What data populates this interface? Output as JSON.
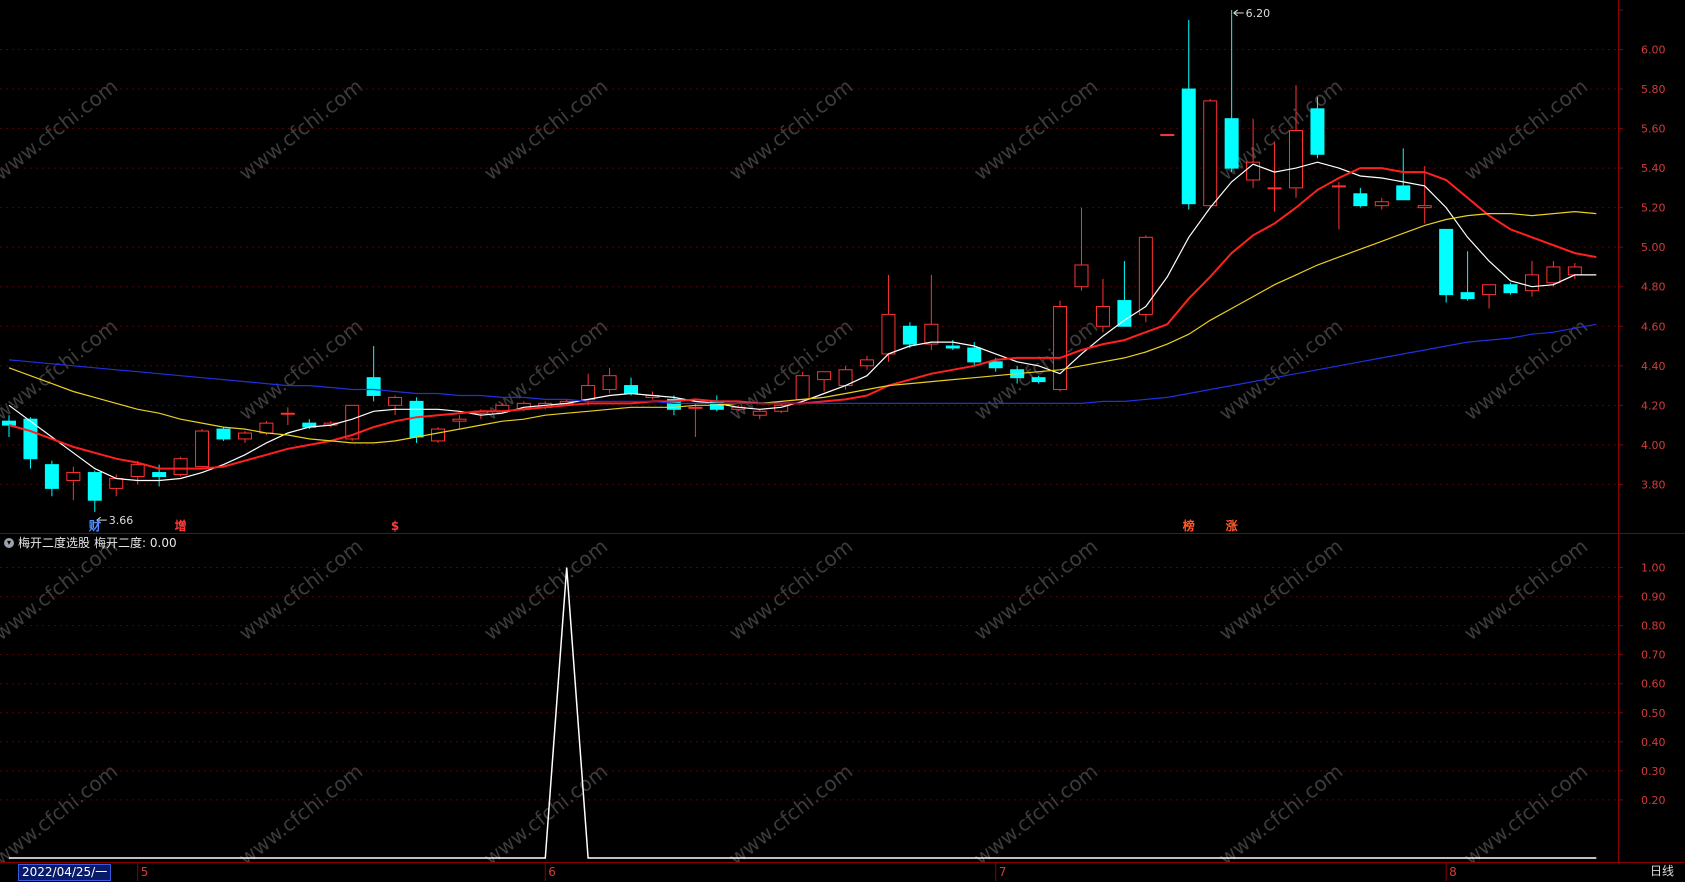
{
  "chart_data": [
    {
      "type": "candlestick",
      "ylim": [
        3.62,
        6.22
      ],
      "y_ticks": [
        3.8,
        4.0,
        4.2,
        4.4,
        4.6,
        4.8,
        5.0,
        5.2,
        5.4,
        5.6,
        5.8,
        6.0
      ],
      "y_tick_labels": [
        "3.80",
        "4.00",
        "4.20",
        "4.40",
        "4.60",
        "4.80",
        "5.00",
        "5.20",
        "5.40",
        "5.60",
        "5.80",
        "6.00"
      ],
      "x_month_labels": [
        {
          "label": "5",
          "index": 6
        },
        {
          "label": "6",
          "index": 25
        },
        {
          "label": "7",
          "index": 46
        },
        {
          "label": "8",
          "index": 67
        }
      ],
      "candles": [
        {
          "o": 4.12,
          "h": 4.15,
          "l": 4.04,
          "c": 4.1
        },
        {
          "o": 4.13,
          "h": 4.14,
          "l": 3.88,
          "c": 3.93
        },
        {
          "o": 3.9,
          "h": 3.92,
          "l": 3.74,
          "c": 3.78
        },
        {
          "o": 3.82,
          "h": 3.89,
          "l": 3.72,
          "c": 3.86
        },
        {
          "o": 3.86,
          "h": 3.87,
          "l": 3.66,
          "c": 3.72
        },
        {
          "o": 3.78,
          "h": 3.85,
          "l": 3.74,
          "c": 3.83
        },
        {
          "o": 3.84,
          "h": 3.92,
          "l": 3.8,
          "c": 3.9
        },
        {
          "o": 3.86,
          "h": 3.9,
          "l": 3.79,
          "c": 3.84
        },
        {
          "o": 3.85,
          "h": 3.94,
          "l": 3.84,
          "c": 3.93
        },
        {
          "o": 3.89,
          "h": 4.08,
          "l": 3.88,
          "c": 4.07
        },
        {
          "o": 4.08,
          "h": 4.09,
          "l": 4.02,
          "c": 4.03
        },
        {
          "o": 4.03,
          "h": 4.07,
          "l": 4.01,
          "c": 4.06
        },
        {
          "o": 4.06,
          "h": 4.12,
          "l": 4.05,
          "c": 4.11
        },
        {
          "o": 4.16,
          "h": 4.19,
          "l": 4.1,
          "c": 4.16
        },
        {
          "o": 4.11,
          "h": 4.13,
          "l": 4.08,
          "c": 4.09
        },
        {
          "o": 4.1,
          "h": 4.12,
          "l": 4.09,
          "c": 4.11
        },
        {
          "o": 4.03,
          "h": 4.2,
          "l": 4.02,
          "c": 4.2
        },
        {
          "o": 4.34,
          "h": 4.5,
          "l": 4.22,
          "c": 4.25
        },
        {
          "o": 4.2,
          "h": 4.25,
          "l": 4.15,
          "c": 4.24
        },
        {
          "o": 4.22,
          "h": 4.24,
          "l": 4.01,
          "c": 4.04
        },
        {
          "o": 4.02,
          "h": 4.09,
          "l": 4.01,
          "c": 4.08
        },
        {
          "o": 4.12,
          "h": 4.15,
          "l": 4.08,
          "c": 4.13
        },
        {
          "o": 4.16,
          "h": 4.18,
          "l": 4.13,
          "c": 4.17
        },
        {
          "o": 4.17,
          "h": 4.21,
          "l": 4.16,
          "c": 4.2
        },
        {
          "o": 4.18,
          "h": 4.22,
          "l": 4.17,
          "c": 4.21
        },
        {
          "o": 4.19,
          "h": 4.22,
          "l": 4.18,
          "c": 4.21
        },
        {
          "o": 4.21,
          "h": 4.23,
          "l": 4.2,
          "c": 4.22
        },
        {
          "o": 4.23,
          "h": 4.36,
          "l": 4.2,
          "c": 4.3
        },
        {
          "o": 4.28,
          "h": 4.39,
          "l": 4.26,
          "c": 4.35
        },
        {
          "o": 4.3,
          "h": 4.34,
          "l": 4.25,
          "c": 4.26
        },
        {
          "o": 4.24,
          "h": 4.27,
          "l": 4.23,
          "c": 4.25
        },
        {
          "o": 4.23,
          "h": 4.25,
          "l": 4.15,
          "c": 4.18
        },
        {
          "o": 4.19,
          "h": 4.21,
          "l": 4.04,
          "c": 4.19
        },
        {
          "o": 4.22,
          "h": 4.25,
          "l": 4.17,
          "c": 4.18
        },
        {
          "o": 4.18,
          "h": 4.2,
          "l": 4.17,
          "c": 4.19
        },
        {
          "o": 4.15,
          "h": 4.18,
          "l": 4.13,
          "c": 4.17
        },
        {
          "o": 4.17,
          "h": 4.21,
          "l": 4.16,
          "c": 4.2
        },
        {
          "o": 4.23,
          "h": 4.37,
          "l": 4.22,
          "c": 4.35
        },
        {
          "o": 4.33,
          "h": 4.37,
          "l": 4.27,
          "c": 4.37
        },
        {
          "o": 4.3,
          "h": 4.4,
          "l": 4.28,
          "c": 4.38
        },
        {
          "o": 4.4,
          "h": 4.45,
          "l": 4.38,
          "c": 4.43
        },
        {
          "o": 4.46,
          "h": 4.86,
          "l": 4.42,
          "c": 4.66
        },
        {
          "o": 4.6,
          "h": 4.62,
          "l": 4.49,
          "c": 4.51
        },
        {
          "o": 4.51,
          "h": 4.86,
          "l": 4.48,
          "c": 4.61
        },
        {
          "o": 4.5,
          "h": 4.53,
          "l": 4.48,
          "c": 4.49
        },
        {
          "o": 4.49,
          "h": 4.52,
          "l": 4.4,
          "c": 4.42
        },
        {
          "o": 4.42,
          "h": 4.44,
          "l": 4.37,
          "c": 4.39
        },
        {
          "o": 4.38,
          "h": 4.4,
          "l": 4.31,
          "c": 4.34
        },
        {
          "o": 4.34,
          "h": 4.35,
          "l": 4.31,
          "c": 4.32
        },
        {
          "o": 4.28,
          "h": 4.73,
          "l": 4.27,
          "c": 4.7
        },
        {
          "o": 4.8,
          "h": 5.2,
          "l": 4.78,
          "c": 4.91
        },
        {
          "o": 4.6,
          "h": 4.84,
          "l": 4.57,
          "c": 4.7
        },
        {
          "o": 4.73,
          "h": 4.93,
          "l": 4.65,
          "c": 4.6
        },
        {
          "o": 4.66,
          "h": 5.06,
          "l": 4.62,
          "c": 5.05
        },
        {
          "o": 5.57,
          "h": 5.57,
          "l": 5.57,
          "c": 5.57
        },
        {
          "o": 5.8,
          "h": 6.15,
          "l": 5.19,
          "c": 5.22
        },
        {
          "o": 5.21,
          "h": 5.75,
          "l": 5.2,
          "c": 5.74
        },
        {
          "o": 5.65,
          "h": 6.2,
          "l": 5.38,
          "c": 5.4
        },
        {
          "o": 5.34,
          "h": 5.65,
          "l": 5.3,
          "c": 5.43
        },
        {
          "o": 5.3,
          "h": 5.53,
          "l": 5.18,
          "c": 5.3
        },
        {
          "o": 5.3,
          "h": 5.82,
          "l": 5.25,
          "c": 5.59
        },
        {
          "o": 5.7,
          "h": 5.76,
          "l": 5.45,
          "c": 5.47
        },
        {
          "o": 5.31,
          "h": 5.33,
          "l": 5.09,
          "c": 5.31
        },
        {
          "o": 5.27,
          "h": 5.3,
          "l": 5.2,
          "c": 5.21
        },
        {
          "o": 5.21,
          "h": 5.25,
          "l": 5.19,
          "c": 5.23
        },
        {
          "o": 5.31,
          "h": 5.5,
          "l": 5.24,
          "c": 5.24
        },
        {
          "o": 5.2,
          "h": 5.41,
          "l": 5.12,
          "c": 5.21
        },
        {
          "o": 5.09,
          "h": 5.09,
          "l": 4.72,
          "c": 4.76
        },
        {
          "o": 4.77,
          "h": 4.98,
          "l": 4.73,
          "c": 4.74
        },
        {
          "o": 4.76,
          "h": 4.8,
          "l": 4.69,
          "c": 4.81
        },
        {
          "o": 4.81,
          "h": 4.82,
          "l": 4.76,
          "c": 4.77
        },
        {
          "o": 4.78,
          "h": 4.93,
          "l": 4.75,
          "c": 4.86
        },
        {
          "o": 4.82,
          "h": 4.93,
          "l": 4.8,
          "c": 4.9
        },
        {
          "o": 4.86,
          "h": 4.92,
          "l": 4.84,
          "c": 4.9
        }
      ],
      "series": [
        {
          "name": "MA5",
          "color": "#ffffff",
          "values": [
            4.2,
            4.12,
            4.04,
            3.96,
            3.88,
            3.83,
            3.82,
            3.82,
            3.83,
            3.86,
            3.9,
            3.95,
            4.01,
            4.06,
            4.09,
            4.1,
            4.13,
            4.17,
            4.18,
            4.18,
            4.18,
            4.17,
            4.15,
            4.16,
            4.19,
            4.2,
            4.21,
            4.23,
            4.25,
            4.26,
            4.25,
            4.24,
            4.22,
            4.21,
            4.19,
            4.18,
            4.19,
            4.22,
            4.26,
            4.3,
            4.35,
            4.46,
            4.5,
            4.52,
            4.52,
            4.5,
            4.46,
            4.42,
            4.4,
            4.36,
            4.46,
            4.55,
            4.63,
            4.7,
            4.85,
            5.05,
            5.2,
            5.33,
            5.42,
            5.38,
            5.4,
            5.43,
            5.4,
            5.36,
            5.35,
            5.33,
            5.31,
            5.2,
            5.05,
            4.93,
            4.83,
            4.8,
            4.81,
            4.86,
            4.86
          ]
        },
        {
          "name": "MA10",
          "color": "#ff2020",
          "values": [
            4.1,
            4.07,
            4.03,
            3.99,
            3.96,
            3.93,
            3.91,
            3.88,
            3.88,
            3.88,
            3.89,
            3.92,
            3.95,
            3.98,
            4.0,
            4.02,
            4.05,
            4.09,
            4.12,
            4.14,
            4.15,
            4.16,
            4.17,
            4.17,
            4.18,
            4.19,
            4.2,
            4.21,
            4.21,
            4.21,
            4.22,
            4.22,
            4.23,
            4.22,
            4.22,
            4.21,
            4.21,
            4.21,
            4.22,
            4.23,
            4.25,
            4.3,
            4.33,
            4.36,
            4.38,
            4.4,
            4.43,
            4.44,
            4.44,
            4.44,
            4.48,
            4.51,
            4.53,
            4.57,
            4.61,
            4.74,
            4.85,
            4.97,
            5.06,
            5.12,
            5.2,
            5.29,
            5.35,
            5.4,
            5.4,
            5.38,
            5.38,
            5.34,
            5.25,
            5.16,
            5.09,
            5.05,
            5.01,
            4.97,
            4.95
          ]
        },
        {
          "name": "MA20",
          "color": "#e8d020",
          "values": [
            4.39,
            4.35,
            4.31,
            4.27,
            4.24,
            4.21,
            4.18,
            4.16,
            4.13,
            4.11,
            4.09,
            4.08,
            4.06,
            4.05,
            4.03,
            4.02,
            4.01,
            4.01,
            4.02,
            4.04,
            4.06,
            4.08,
            4.1,
            4.12,
            4.13,
            4.15,
            4.16,
            4.17,
            4.18,
            4.19,
            4.19,
            4.19,
            4.2,
            4.2,
            4.21,
            4.21,
            4.22,
            4.23,
            4.24,
            4.26,
            4.28,
            4.3,
            4.31,
            4.32,
            4.33,
            4.34,
            4.35,
            4.36,
            4.37,
            4.38,
            4.4,
            4.42,
            4.44,
            4.47,
            4.51,
            4.56,
            4.63,
            4.69,
            4.75,
            4.81,
            4.86,
            4.91,
            4.95,
            4.99,
            5.03,
            5.07,
            5.11,
            5.14,
            5.16,
            5.17,
            5.17,
            5.16,
            5.17,
            5.18,
            5.17
          ]
        },
        {
          "name": "MA60",
          "color": "#2030e0",
          "values": [
            4.43,
            4.42,
            4.41,
            4.4,
            4.39,
            4.38,
            4.37,
            4.36,
            4.35,
            4.34,
            4.33,
            4.32,
            4.31,
            4.3,
            4.3,
            4.29,
            4.28,
            4.28,
            4.27,
            4.26,
            4.26,
            4.25,
            4.25,
            4.24,
            4.24,
            4.23,
            4.23,
            4.22,
            4.22,
            4.22,
            4.22,
            4.21,
            4.21,
            4.21,
            4.21,
            4.21,
            4.21,
            4.21,
            4.21,
            4.21,
            4.21,
            4.21,
            4.21,
            4.21,
            4.21,
            4.21,
            4.21,
            4.21,
            4.21,
            4.21,
            4.21,
            4.22,
            4.22,
            4.23,
            4.24,
            4.26,
            4.28,
            4.3,
            4.32,
            4.34,
            4.36,
            4.38,
            4.4,
            4.42,
            4.44,
            4.46,
            4.48,
            4.5,
            4.52,
            4.53,
            4.54,
            4.56,
            4.57,
            4.59,
            4.61
          ]
        }
      ],
      "annotations": [
        {
          "text": "6.20",
          "index": 57,
          "value": 6.2
        },
        {
          "text": "3.66",
          "index": 4,
          "value": 3.66
        }
      ],
      "event_markers": [
        {
          "text": "财",
          "index": 4,
          "color": "#4f8cff"
        },
        {
          "text": "增",
          "index": 8,
          "color": "#ff3a3a"
        },
        {
          "text": "$",
          "index": 18,
          "color": "#ff3a3a"
        },
        {
          "text": "榜",
          "index": 55,
          "color": "#ff5a2a"
        },
        {
          "text": "涨",
          "index": 57,
          "color": "#ff5a2a"
        }
      ]
    },
    {
      "type": "line",
      "title": "梅开二度选股",
      "ylim": [
        0,
        1.05
      ],
      "y_ticks": [
        0.2,
        0.3,
        0.4,
        0.5,
        0.6,
        0.7,
        0.8,
        0.9,
        1.0
      ],
      "y_tick_labels": [
        "0.20",
        "0.30",
        "0.40",
        "0.50",
        "0.60",
        "0.70",
        "0.80",
        "0.90",
        "1.00"
      ],
      "series": [
        {
          "name": "梅开二度",
          "color": "#ffffff",
          "values": [
            0,
            0,
            0,
            0,
            0,
            0,
            0,
            0,
            0,
            0,
            0,
            0,
            0,
            0,
            0,
            0,
            0,
            0,
            0,
            0,
            0,
            0,
            0,
            0,
            0,
            0,
            1,
            0,
            0,
            0,
            0,
            0,
            0,
            0,
            0,
            0,
            0,
            0,
            0,
            0,
            0,
            0,
            0,
            0,
            0,
            0,
            0,
            0,
            0,
            0,
            0,
            0,
            0,
            0,
            0,
            0,
            0,
            0,
            0,
            0,
            0,
            0,
            0,
            0,
            0,
            0,
            0,
            0,
            0,
            0,
            0,
            0,
            0,
            0,
            0
          ]
        }
      ]
    }
  ],
  "indicator_header": {
    "name": "梅开二度选股",
    "value_label": "梅开二度: 0.00"
  },
  "footer": {
    "selected_date": "2022/04/25/一",
    "period": "日线"
  },
  "watermark": "www.cfchi.com",
  "colors": {
    "up": "#ff3232",
    "down": "#00ffff",
    "axis": "#8a0000",
    "grid": "#5a0000",
    "tick_text": "#d23c3c"
  }
}
